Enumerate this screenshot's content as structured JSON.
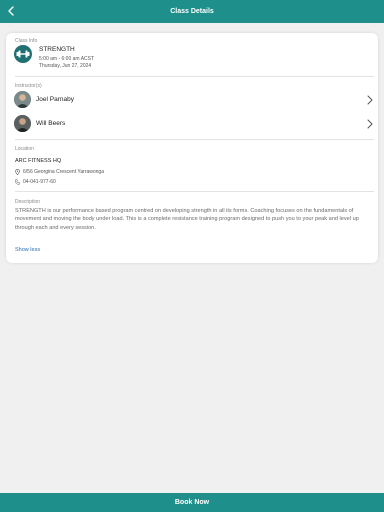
{
  "header": {
    "title": "Class Details",
    "back_icon": "chevron-left-icon"
  },
  "class_info": {
    "section_label": "Class Info",
    "name": "STRENGTH",
    "time": "5:00 am - 6:00 am ACST",
    "date": "Thursday, Jun 27, 2024",
    "icon": "dumbbell-icon",
    "accent_color": "#1f6f73"
  },
  "instructors": {
    "section_label": "Instructor(s)",
    "items": [
      {
        "name": "Joel Parnaby"
      },
      {
        "name": "Will Beers"
      }
    ]
  },
  "location": {
    "section_label": "Location",
    "name": "ARC FITNESS HQ",
    "address": "6/56 Georgina Crescent Yarrawonga",
    "phone": "04-041-977-60"
  },
  "description": {
    "section_label": "Description",
    "text": "STRENGTH is our performance based program centred on developing strength in all its forms. Coaching focuses on the fundamentals of movement and moving the body under load. This is a complete resistance training program designed to push you to your peak and level up through each and every session.",
    "toggle_label": "Show less"
  },
  "footer": {
    "book_label": "Book Now"
  },
  "colors": {
    "brand": "#1f8f8b",
    "link": "#2a6fb3",
    "background": "#f0f0f0"
  }
}
